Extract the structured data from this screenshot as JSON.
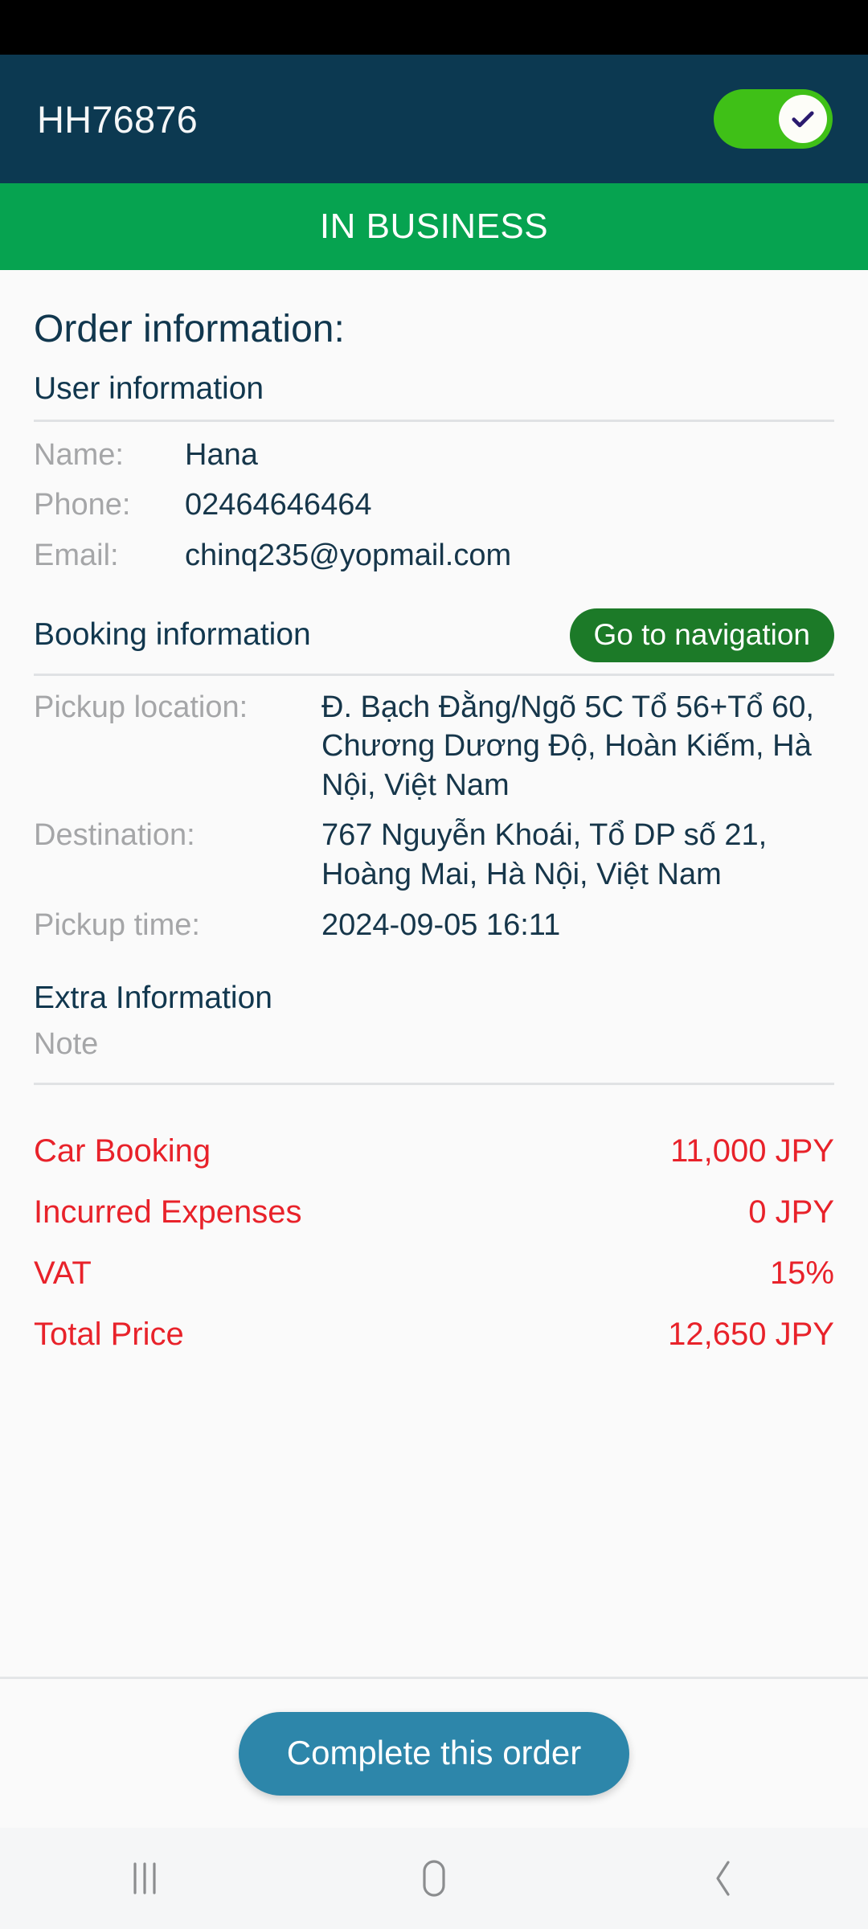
{
  "app_bar": {
    "title": "HH76876",
    "toggle": {
      "state": "on",
      "icon": "check-icon",
      "track_color": "#3fc017",
      "knob_color": "#fdfdf8",
      "check_color": "#2a1a6e"
    }
  },
  "status_banner": {
    "label": "IN BUSINESS",
    "background": "#06a350",
    "text_color": "#ffffff"
  },
  "content": {
    "order_heading": "Order information:",
    "user_section": {
      "heading": "User information",
      "rows": [
        {
          "key": "Name:",
          "value": "Hana"
        },
        {
          "key": "Phone:",
          "value": "02464646464"
        },
        {
          "key": "Email:",
          "value": "chinq235@yopmail.com"
        }
      ]
    },
    "booking_section": {
      "heading": "Booking information",
      "nav_button_label": "Go to navigation",
      "rows": [
        {
          "key": "Pickup location:",
          "value": "Đ. Bạch Đằng/Ngõ 5C Tổ 56+Tổ 60, Chương Dương Độ, Hoàn Kiếm, Hà Nội, Việt Nam"
        },
        {
          "key": "Destination:",
          "value": "767 Nguyễn Khoái, Tổ DP số 21, Hoàng Mai, Hà Nội, Việt Nam"
        },
        {
          "key": "Pickup time:",
          "value": "2024-09-05 16:11"
        }
      ]
    },
    "extra_section": {
      "heading": "Extra Information",
      "note_placeholder": "Note",
      "note_value": ""
    },
    "price_section": {
      "accent_color": "#e8222a",
      "rows": [
        {
          "label": "Car Booking",
          "value": "11,000 JPY"
        },
        {
          "label": "Incurred Expenses",
          "value": "0 JPY"
        },
        {
          "label": "VAT",
          "value": "15%"
        },
        {
          "label": "Total Price",
          "value": "12,650 JPY"
        }
      ]
    }
  },
  "action_bar": {
    "complete_label": "Complete this order",
    "button_color": "#2d86aa"
  },
  "nav_bar": {
    "recents_icon": "recents-icon",
    "home_icon": "home-icon",
    "back_icon": "back-icon"
  }
}
